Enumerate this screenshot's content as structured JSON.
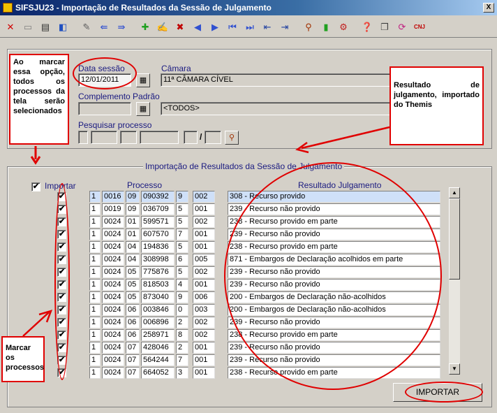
{
  "window": {
    "title": "SIFSJU23 - Importação de Resultados da Sessão de Julgamento",
    "close": "X"
  },
  "toolbar": {
    "icons": [
      "close-icon",
      "save-icon",
      "print-icon",
      "exit-icon",
      "tool-icon",
      "prev-page-icon",
      "next-page-icon",
      "new-record-icon",
      "edit-icon",
      "clear-icon",
      "arrow-left-icon",
      "arrow-right-icon",
      "first-icon",
      "last-icon",
      "import-icon",
      "export-icon",
      "filter-icon",
      "traffic-light-icon",
      "printer-setup-icon",
      "help-icon",
      "copy-icon",
      "refresh-icon",
      "cnj-nup-icon"
    ]
  },
  "form": {
    "data_sessao_label": "Data sessão",
    "data_sessao_value": "12/01/2011",
    "camara_label": "Câmara",
    "camara_value": "11ª CÂMARA CÍVEL",
    "complemento_label": "Complemento Padrão",
    "complemento_code": "",
    "complemento_value": "<TODOS>",
    "pesquisar_label": "Pesquisar processo",
    "pesquisar_separator": "/"
  },
  "section": {
    "title": "Importação de Resultados da Sessão de Julgamento",
    "importar_label": "Importar",
    "importar_all_checked": "✔",
    "processo_header": "Processo",
    "resultado_header": "Resultado Julgamento"
  },
  "rows": [
    {
      "check": "✔",
      "p1": "1",
      "p2": "0016",
      "p3": "09",
      "p4": "090392",
      "p5": "9",
      "p6": "002",
      "resultado": "308 - Recurso provido"
    },
    {
      "check": "✔",
      "p1": "1",
      "p2": "0019",
      "p3": "09",
      "p4": "036709",
      "p5": "5",
      "p6": "001",
      "resultado": "239 - Recurso não provido"
    },
    {
      "check": "✔",
      "p1": "1",
      "p2": "0024",
      "p3": "01",
      "p4": "599571",
      "p5": "5",
      "p6": "002",
      "resultado": "238 - Recurso provido em parte"
    },
    {
      "check": "✔",
      "p1": "1",
      "p2": "0024",
      "p3": "01",
      "p4": "607570",
      "p5": "7",
      "p6": "001",
      "resultado": "239 - Recurso não provido"
    },
    {
      "check": "✔",
      "p1": "1",
      "p2": "0024",
      "p3": "04",
      "p4": "194836",
      "p5": "5",
      "p6": "001",
      "resultado": "238 - Recurso provido em parte"
    },
    {
      "check": "✔",
      "p1": "1",
      "p2": "0024",
      "p3": "04",
      "p4": "308998",
      "p5": "6",
      "p6": "005",
      "resultado": "871 - Embargos de Declaração acolhidos em parte"
    },
    {
      "check": "✔",
      "p1": "1",
      "p2": "0024",
      "p3": "05",
      "p4": "775876",
      "p5": "5",
      "p6": "002",
      "resultado": "239 - Recurso não provido"
    },
    {
      "check": "✔",
      "p1": "1",
      "p2": "0024",
      "p3": "05",
      "p4": "818503",
      "p5": "4",
      "p6": "001",
      "resultado": "239 - Recurso não provido"
    },
    {
      "check": "✔",
      "p1": "1",
      "p2": "0024",
      "p3": "05",
      "p4": "873040",
      "p5": "9",
      "p6": "006",
      "resultado": "200 - Embargos de Declaração não-acolhidos"
    },
    {
      "check": "✔",
      "p1": "1",
      "p2": "0024",
      "p3": "06",
      "p4": "003846",
      "p5": "0",
      "p6": "003",
      "resultado": "200 - Embargos de Declaração não-acolhidos"
    },
    {
      "check": "✔",
      "p1": "1",
      "p2": "0024",
      "p3": "06",
      "p4": "006896",
      "p5": "2",
      "p6": "002",
      "resultado": "239 - Recurso não provido"
    },
    {
      "check": "✔",
      "p1": "1",
      "p2": "0024",
      "p3": "06",
      "p4": "258971",
      "p5": "8",
      "p6": "002",
      "resultado": "238 - Recurso provido em parte"
    },
    {
      "check": "✔",
      "p1": "1",
      "p2": "0024",
      "p3": "07",
      "p4": "428046",
      "p5": "2",
      "p6": "001",
      "resultado": "239 - Recurso não provido"
    },
    {
      "check": "✔",
      "p1": "1",
      "p2": "0024",
      "p3": "07",
      "p4": "564244",
      "p5": "7",
      "p6": "001",
      "resultado": "239 - Recurso não provido"
    },
    {
      "check": "✔",
      "p1": "1",
      "p2": "0024",
      "p3": "07",
      "p4": "664052",
      "p5": "3",
      "p6": "001",
      "resultado": "238 - Recurso provido em parte"
    }
  ],
  "import_button": "IMPORTAR",
  "scrollbar": {
    "up": "▲",
    "down": "▼"
  },
  "annotations": {
    "marcar_opcao": "Ao marcar essa opção, todos os processos da tela serão selecionados",
    "resultado_themis": "Resultado de julgamento, importado do Themis",
    "marcar_processos": "Marcar os processos"
  },
  "colors": {
    "annotation_red": "#e00000",
    "label_blue": "#1a1a80",
    "title_bar": "#0a246a"
  }
}
